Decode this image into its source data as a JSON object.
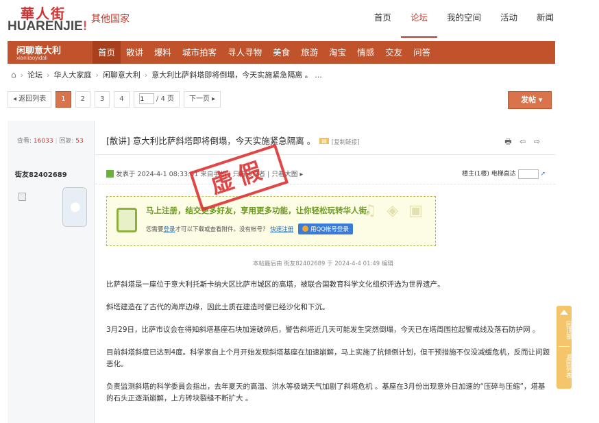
{
  "header": {
    "logo_cn": "華人街",
    "logo_en_main": "HUARENJIE",
    "logo_en_mark": "!",
    "site_section": "其他国家",
    "nav": [
      "首页",
      "论坛",
      "我的空间",
      "活动",
      "新闻"
    ],
    "active_nav": "论坛"
  },
  "forum_bar": {
    "title": "闲聊意大利",
    "subtitle": "xianliaoyidali",
    "nav": [
      "首页",
      "散讲",
      "爆料",
      "城市拍客",
      "寻人寻物",
      "美食",
      "旅游",
      "淘宝",
      "情感",
      "交友",
      "问答"
    ],
    "active": "首页"
  },
  "breadcrumb": [
    "论坛",
    "华人大家庭",
    "闲聊意大利",
    "意大利比萨斜塔即将倒塌，今天实施紧急隔离 。 ..."
  ],
  "pager": {
    "back": "◂ 返回列表",
    "pages": [
      "1",
      "2",
      "3",
      "4"
    ],
    "current": "1",
    "input_value": "1",
    "total": "/ 4 页",
    "next": "下一页 ▸",
    "post_button": "发帖 ▾"
  },
  "sidebar": {
    "views_label": "查看:",
    "views": "16033",
    "replies_label": "回复:",
    "replies": "53",
    "username": "街友82402689"
  },
  "post": {
    "title": "[散讲] 意大利比萨斜塔即将倒塌，今天实施紧急隔离 。",
    "copy_link": "[复制链接]",
    "tools": "🖶 ⇦ ⇨",
    "meta": "发表于 2024-4-1 08:33:01  来自手机 | 只看该作者 | 只看大图 ▸",
    "floor": "楼主(1楼)   电梯直达",
    "stamp": "虚假",
    "notice_title": "马上注册，结交更多好友，享用更多功能，让你轻松玩转华人街。",
    "notice_text_pre": "您需要",
    "notice_login": "登录",
    "notice_text_mid": "才可以下载或查看附件。没有帐号？",
    "notice_register": "快速注册",
    "qq_button": "用QQ帐号登录",
    "edited": "本帖最后由 街友82402689 于 2024-4-4 01:49 编辑",
    "paragraphs": [
      "比萨斜塔是一座位于意大利托斯卡纳大区比萨市城区的高塔，被联合国教育科学文化组织评选为世界遗产。",
      "斜塔建造在了古代的海岸边缘，因此土质在建造时便已经沙化和下沉。",
      "3月29日，比萨市议会在得知斜塔基座石块加速破碎后，警告斜塔近几天可能发生突然倒塌，今天已在塔周围拉起警戒线及落石防护网 。",
      "目前斜塔斜度已达到4度。科学家自上个月开始发现斜塔基座在加速崩解，马上实施了抗倾倒计划，但干预措施不仅没减缓危机，反而让问题恶化。",
      "负责监测斜塔的科学委員会指出，去年夏天的高温、洪水等极端天气加剧了斜塔危机 。基座在3月份出现意外日加速的“压碎与压缩”，塔基的石头正逐渐崩解，上方砖块裂缝不断扩大 。"
    ]
  },
  "float_buttons": {
    "top": "回顶部",
    "back": "返回列表"
  },
  "colors": {
    "brand": "#c0532c",
    "accent": "#d9734b",
    "stamp": "#dd3333"
  }
}
